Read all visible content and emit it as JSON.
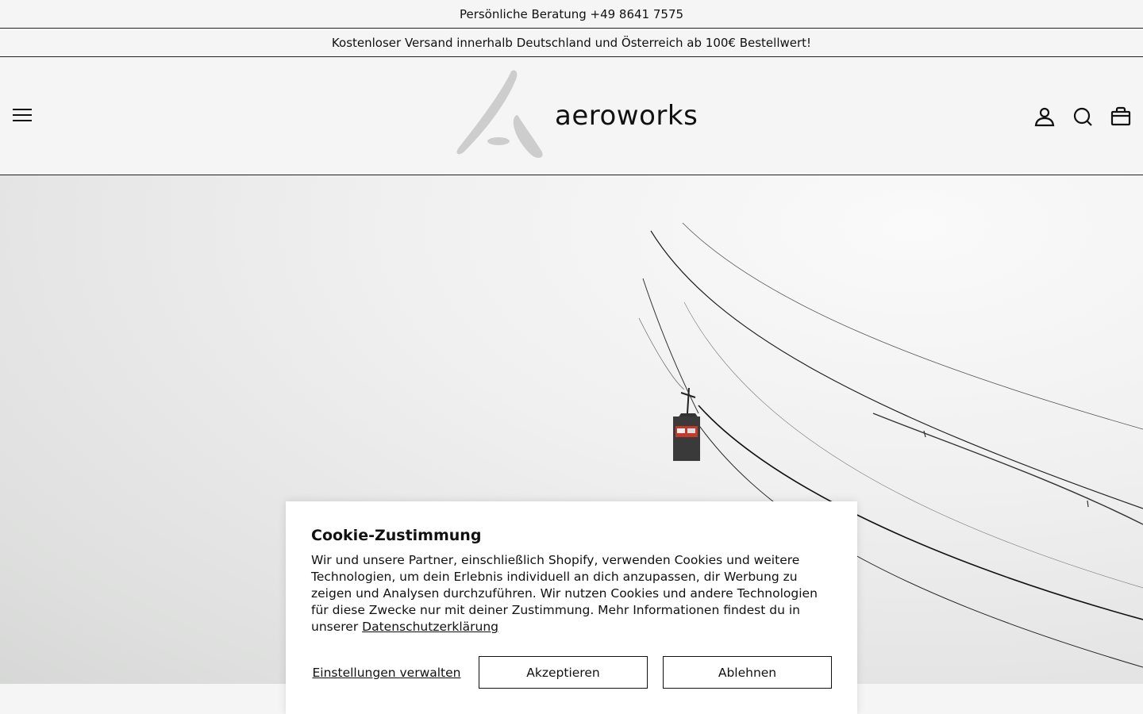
{
  "topbar": {
    "consultation": "Persönliche Beratung +49 8641 7575"
  },
  "shipping_bar": {
    "text": "Kostenloser Versand innerhalb Deutschland und Österreich ab 100€ Bestellwert!"
  },
  "header": {
    "brand": "aeroworks",
    "icons": [
      "menu-icon",
      "account-icon",
      "search-icon",
      "cart-icon"
    ]
  },
  "cookie": {
    "title": "Cookie-Zustimmung",
    "body": "Wir und unsere Partner, einschließlich Shopify, verwenden Cookies und weitere Technologien, um dein Erlebnis individuell an dich anzupassen, dir Werbung zu zeigen und Analysen durchzuführen. Wir nutzen Cookies und andere Technologien für diese Zwecke nur mit deiner Zustimmung. Mehr Informationen findest du in unserer",
    "privacy_link": "Datenschutzerklärung",
    "manage_label": "Einstellungen verwalten",
    "accept_label": "Akzeptieren",
    "decline_label": "Ablehnen"
  },
  "colors": {
    "border": "#222222",
    "background": "#f5f5f5",
    "logo_grey": "#cdcdcd",
    "gondola_red": "#c0392b"
  }
}
